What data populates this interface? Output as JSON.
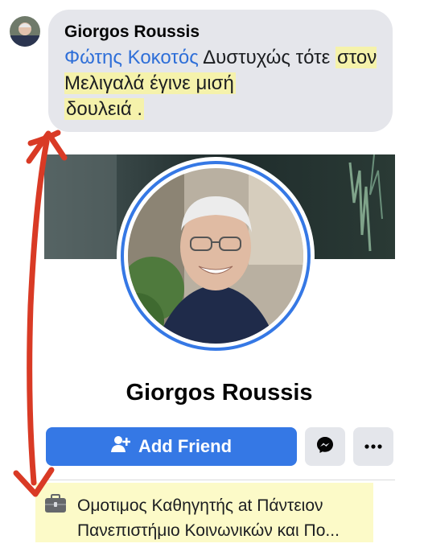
{
  "comment": {
    "author": "Giorgos Roussis",
    "mention": "Φώτης Κοκοτός",
    "text_parts": [
      "Δυστυχώς τότε",
      "στον Μελιγαλά έγινε μισή",
      "δουλειά ."
    ]
  },
  "profile": {
    "name": "Giorgos Roussis"
  },
  "actions": {
    "add_friend_label": "Add Friend",
    "messenger_icon": "messenger-icon",
    "more_icon": "more-icon"
  },
  "work": {
    "icon": "briefcase-icon",
    "line1": "Ομοτιμος Καθηγητής at Πάντειον",
    "line2": "Πανεπιστήμιο Κοινωνικών και Πο..."
  },
  "colors": {
    "accent": "#3578e5",
    "mention": "#2f6fd8",
    "highlight": "#faf596",
    "annotation_arrow": "#d93a25"
  }
}
